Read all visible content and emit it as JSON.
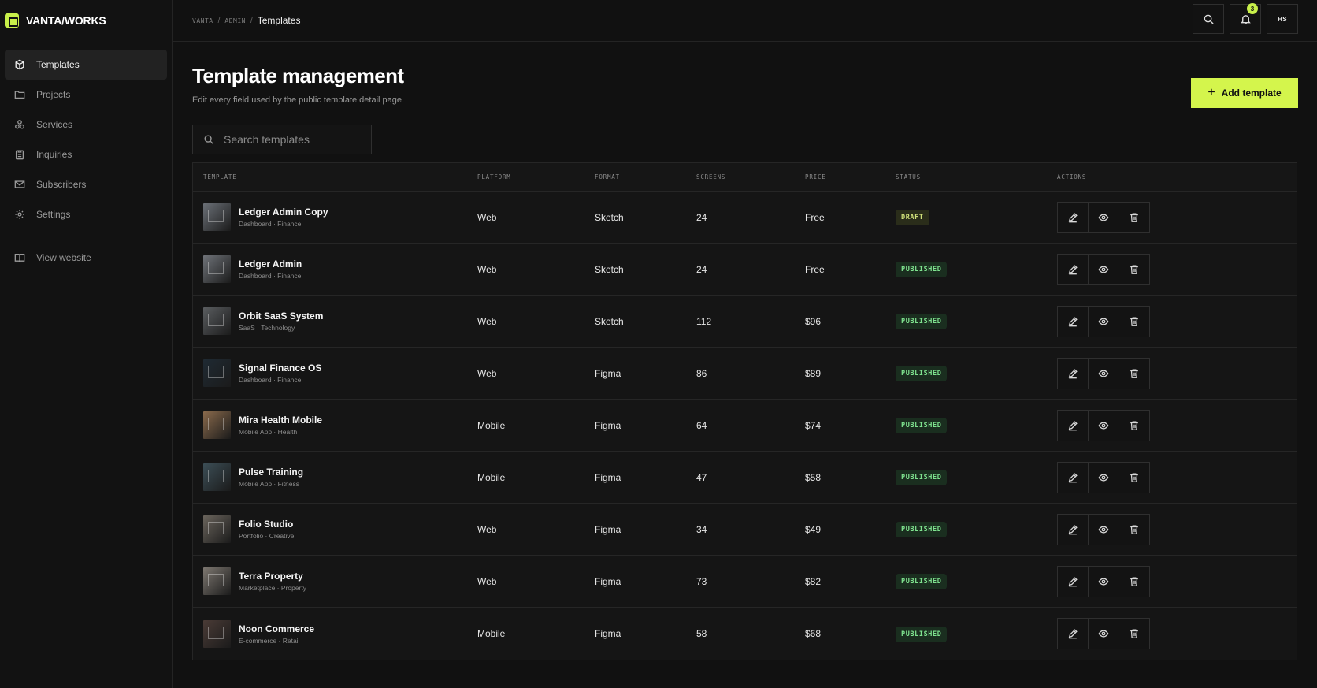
{
  "brand": {
    "name": "VANTA/WORKS",
    "accent": "#c8f04a"
  },
  "sidebar": {
    "items": [
      {
        "label": "Templates",
        "icon": "box-icon",
        "active": true
      },
      {
        "label": "Projects",
        "icon": "folder-icon",
        "active": false
      },
      {
        "label": "Services",
        "icon": "layers-icon",
        "active": false
      },
      {
        "label": "Inquiries",
        "icon": "clipboard-icon",
        "active": false
      },
      {
        "label": "Subscribers",
        "icon": "mail-icon",
        "active": false
      },
      {
        "label": "Settings",
        "icon": "gear-icon",
        "active": false
      }
    ],
    "footer_link": {
      "label": "View website",
      "icon": "book-icon"
    }
  },
  "topbar": {
    "breadcrumb": [
      "VANTA",
      "ADMIN"
    ],
    "breadcrumb_current": "Templates",
    "notification_count": "3",
    "avatar_initials": "HS"
  },
  "page": {
    "title": "Template management",
    "subtitle": "Edit every field used by the public template detail page.",
    "add_button_label": "Add template"
  },
  "search": {
    "placeholder": "Search templates"
  },
  "table": {
    "columns": [
      "TEMPLATE",
      "PLATFORM",
      "FORMAT",
      "SCREENS",
      "PRICE",
      "STATUS",
      "ACTIONS"
    ],
    "rows": [
      {
        "name": "Ledger Admin Copy",
        "meta": "Dashboard · Finance",
        "platform": "Web",
        "format": "Sketch",
        "screens": "24",
        "price": "Free",
        "status": "DRAFT",
        "thumb": "#6b7077"
      },
      {
        "name": "Ledger Admin",
        "meta": "Dashboard · Finance",
        "platform": "Web",
        "format": "Sketch",
        "screens": "24",
        "price": "Free",
        "status": "PUBLISHED",
        "thumb": "#6f7379"
      },
      {
        "name": "Orbit SaaS System",
        "meta": "SaaS · Technology",
        "platform": "Web",
        "format": "Sketch",
        "screens": "112",
        "price": "$96",
        "status": "PUBLISHED",
        "thumb": "#5a5d60"
      },
      {
        "name": "Signal Finance OS",
        "meta": "Dashboard · Finance",
        "platform": "Web",
        "format": "Figma",
        "screens": "86",
        "price": "$89",
        "status": "PUBLISHED",
        "thumb": "#1f2a33"
      },
      {
        "name": "Mira Health Mobile",
        "meta": "Mobile App · Health",
        "platform": "Mobile",
        "format": "Figma",
        "screens": "64",
        "price": "$74",
        "status": "PUBLISHED",
        "thumb": "#8a6a4c"
      },
      {
        "name": "Pulse Training",
        "meta": "Mobile App · Fitness",
        "platform": "Mobile",
        "format": "Figma",
        "screens": "47",
        "price": "$58",
        "status": "PUBLISHED",
        "thumb": "#3c4e56"
      },
      {
        "name": "Folio Studio",
        "meta": "Portfolio · Creative",
        "platform": "Web",
        "format": "Figma",
        "screens": "34",
        "price": "$49",
        "status": "PUBLISHED",
        "thumb": "#6a645c"
      },
      {
        "name": "Terra Property",
        "meta": "Marketplace · Property",
        "platform": "Web",
        "format": "Figma",
        "screens": "73",
        "price": "$82",
        "status": "PUBLISHED",
        "thumb": "#7d7770"
      },
      {
        "name": "Noon Commerce",
        "meta": "E-commerce · Retail",
        "platform": "Mobile",
        "format": "Figma",
        "screens": "58",
        "price": "$68",
        "status": "PUBLISHED",
        "thumb": "#4a3b36"
      }
    ]
  }
}
